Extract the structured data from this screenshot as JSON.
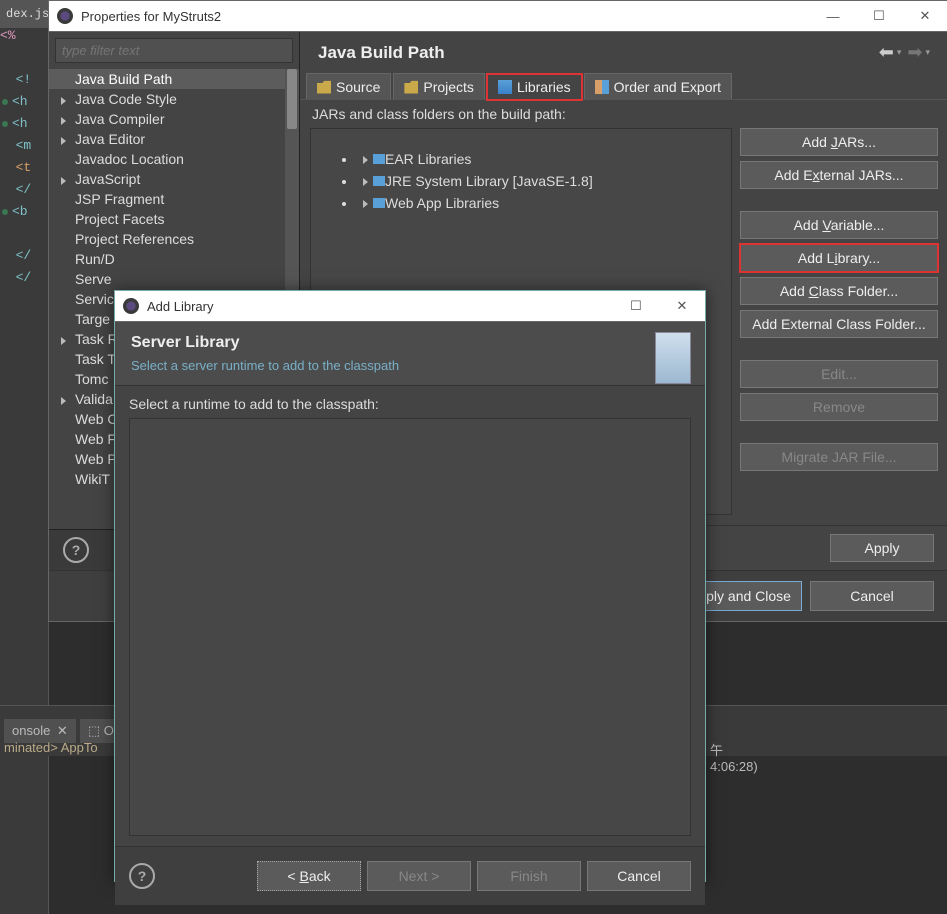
{
  "editor": {
    "tab": "dex.js",
    "lines": [
      "<%",
      "",
      "<!",
      "<h",
      "<h",
      "<m",
      "<t",
      "</",
      "<b",
      "",
      "</",
      "</"
    ]
  },
  "props": {
    "title": "Properties for MyStruts2",
    "filter_placeholder": "type filter text",
    "tree": [
      "Java Build Path",
      "Java Code Style",
      "Java Compiler",
      "Java Editor",
      "Javadoc Location",
      "JavaScript",
      "JSP Fragment",
      "Project Facets",
      "Project References",
      "Run/D",
      "Serve",
      "Servic",
      "Targe",
      "Task R",
      "Task T",
      "Tomc",
      "Valida",
      "Web C",
      "Web F",
      "Web P",
      "WikiT"
    ],
    "expandable_idx": [
      1,
      2,
      3,
      5,
      13,
      16
    ],
    "selected_idx": 0,
    "page_title": "Java Build Path",
    "tabs": [
      {
        "label": "Source",
        "icon": "folder"
      },
      {
        "label": "Projects",
        "icon": "folder"
      },
      {
        "label": "Libraries",
        "icon": "jar"
      },
      {
        "label": "Order and Export",
        "icon": "order"
      }
    ],
    "active_tab": 2,
    "subhead": "JARs and class folders on the build path:",
    "libs": [
      "EAR Libraries",
      "JRE System Library [JavaSE-1.8]",
      "Web App Libraries"
    ],
    "buttons": {
      "add_jars": "Add JARs...",
      "add_ext_jars": "Add External JARs...",
      "add_var": "Add Variable...",
      "add_lib": "Add Library...",
      "add_cf": "Add Class Folder...",
      "add_ext_cf": "Add External Class Folder...",
      "edit": "Edit...",
      "remove": "Remove",
      "migrate": "Migrate JAR File..."
    },
    "footer": {
      "apply": "Apply",
      "apply_close": "Apply and Close",
      "cancel": "Cancel"
    }
  },
  "console": {
    "tab": "onsole",
    "outline": "Ou",
    "term": "minated> AppTo",
    "time": "午4:06:28)"
  },
  "addlib": {
    "title": "Add Library",
    "header": "Server Library",
    "sub": "Select a server runtime to add to the classpath",
    "label": "Select a runtime to add to the classpath:",
    "back": "< Back",
    "next": "Next >",
    "finish": "Finish",
    "cancel": "Cancel"
  }
}
